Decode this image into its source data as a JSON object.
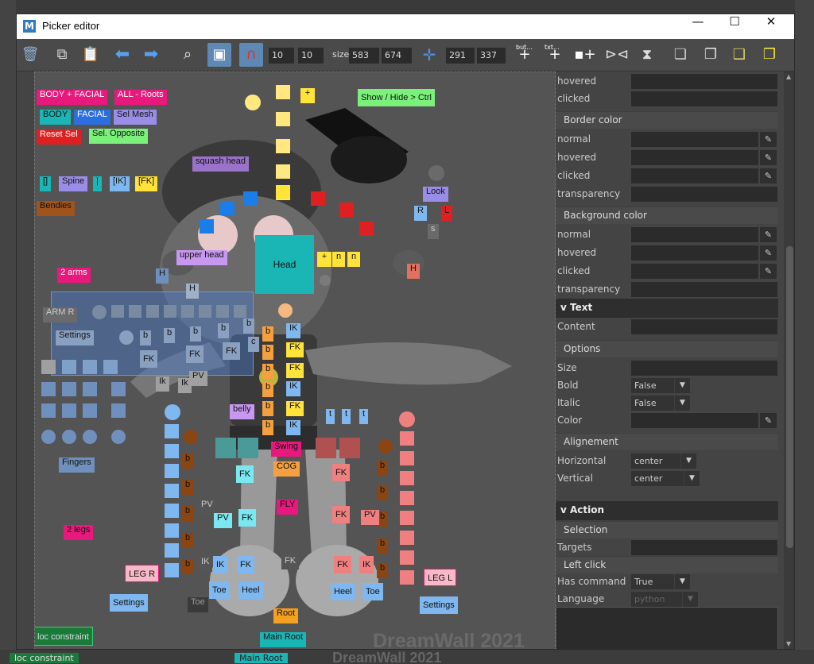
{
  "window": {
    "title": "Picker editor",
    "app_icon": "M"
  },
  "toolbar": {
    "snap_x": "10",
    "snap_y": "10",
    "size_label": "size",
    "size_w": "583",
    "size_h": "674",
    "pos_x": "291",
    "pos_y": "337",
    "add_button_label": "but...",
    "add_text_label": "txt..."
  },
  "canvas": {
    "watermark": "DreamWall 2021",
    "buttons": {
      "body_facial_all": "BODY + FACIAL",
      "all_roots": "ALL - Roots",
      "show_hide": "Show / Hide > Ctrl",
      "body": "BODY",
      "facial": "FACIAL",
      "sel_mesh": "Sel Mesh",
      "reset_sel": "Reset Sel",
      "sel_opposite": "Sel. Opposite",
      "squash_head": "squash head",
      "bracket": "[]",
      "spine": "Spine",
      "bar": "|",
      "ik_spine": "[IK]",
      "fk_spine": "[FK]",
      "bendies": "Bendies",
      "look": "Look",
      "r": "R",
      "l": "L",
      "s": "s",
      "upper_head": "upper head",
      "head": "Head",
      "n1": "n",
      "n2": "n",
      "plus1": "+",
      "plus2": "+",
      "two_arms": "2 arms",
      "h_left": "H",
      "h_mid": "H",
      "h_right": "H",
      "arm_r": "ARM R",
      "settings_arm": "Settings",
      "b1": "b",
      "b2": "b",
      "b3": "b",
      "b4": "b",
      "b5": "b",
      "c": "c",
      "fk_a1": "FK",
      "fk_a2": "FK",
      "fk_a3": "FK",
      "ik_a": "Ik",
      "ik_a2": "Ik",
      "pv_a": "PV",
      "spine_b1": "b",
      "spine_b2": "b",
      "spine_b3": "b",
      "spine_b4": "b",
      "spine_b5": "b",
      "spine_b6": "b",
      "spine_ik1": "IK",
      "spine_fk1": "FK",
      "spine_fk2": "FK",
      "spine_ik2": "IK",
      "spine_fk3": "FK",
      "spine_ik3": "IK",
      "belly": "belly",
      "t1": "t",
      "t2": "t",
      "t3": "t",
      "fingers": "Fingers",
      "swing": "Swing",
      "cog": "COG",
      "fk_l1": "FK",
      "fk_r1": "FK",
      "fly": "FLY",
      "pv_l": "PV",
      "pv_l2": "PV",
      "fk_l2": "FK",
      "fk_r2": "FK",
      "pv_r": "PV",
      "two_legs": "2 legs",
      "leg_r": "LEG R",
      "leg_l": "LEG L",
      "settings_leg_r": "Settings",
      "settings_leg_l": "Settings",
      "ik_l": "IK",
      "ik_l_dark": "IK",
      "fk_l3": "FK",
      "fk_dark": "FK",
      "fk_r3": "FK",
      "ik_r": "IK",
      "toe_l": "Toe",
      "heel_l": "Heel",
      "heel_r": "Heel",
      "toe_r": "Toe",
      "toe_dark": "Toe",
      "root": "Root",
      "main_root": "Main Root",
      "loc_constraint": "loc constraint",
      "loc1": "loc",
      "loc2": "loc",
      "lb1": "b",
      "lb2": "b",
      "lb3": "b",
      "lb4": "b",
      "lb5": "b",
      "lb6": "b",
      "rb1": "b",
      "rb2": "b",
      "rb3": "b",
      "rb4": "b",
      "rb5": "b",
      "rb6": "b",
      "pv_leg": "PV"
    }
  },
  "panel": {
    "hovered_1": "hovered",
    "clicked_1": "clicked",
    "border_color": "Border color",
    "normal_b": "normal",
    "hovered_b": "hovered",
    "clicked_b": "clicked",
    "transparency_b": "transparency",
    "background_color": "Background color",
    "normal_bg": "normal",
    "hovered_bg": "hovered",
    "clicked_bg": "clicked",
    "transparency_bg": "transparency",
    "text_header": "v Text",
    "content": "Content",
    "options": "Options",
    "size": "Size",
    "bold": "Bold",
    "bold_value": "False",
    "italic": "Italic",
    "italic_value": "False",
    "color": "Color",
    "alignement": "Alignement",
    "horizontal": "Horizontal",
    "horizontal_value": "center",
    "vertical": "Vertical",
    "vertical_value": "center",
    "action_header": "v Action",
    "selection": "Selection",
    "targets": "Targets",
    "left_click": "Left click",
    "has_command": "Has command",
    "has_command_value": "True",
    "language": "Language",
    "language_value": "python"
  },
  "background": {
    "bottom_text_left": "loc constraint",
    "bottom_text_mid": "Main Root",
    "bottom_watermark": "DreamWall 2021"
  },
  "colors": {
    "accent_blue": "#5d89b4",
    "pink": "#e8187c",
    "yellow": "#ffe23a",
    "light_blue": "#7fb8f0",
    "salmon": "#f08080",
    "teal": "#1ab5b5",
    "green": "#2e8b57"
  }
}
